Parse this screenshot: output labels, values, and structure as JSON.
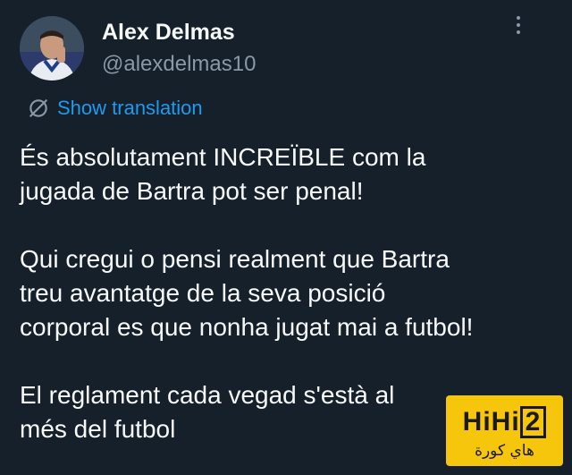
{
  "author": {
    "display_name": "Alex Delmas",
    "handle": "@alexdelmas10"
  },
  "more_menu_icon": "more-vertical-icon",
  "translation": {
    "icon": "globe-slash-icon",
    "label": "Show translation"
  },
  "tweet": {
    "paragraphs": [
      [
        "És absolutament INCREÏBLE com la",
        "jugada de Bartra pot ser penal!"
      ],
      [
        "Qui cregui o pensi realment que Bartra",
        "treu avantatge de la seva posició",
        "corporal es que nonha jugat mai a futbol!"
      ],
      [
        "El reglament cada vegad s'està al",
        "més del futbol"
      ]
    ]
  },
  "watermark": {
    "brand_prefix": "HiHi",
    "brand_digit": "2",
    "arabic": "هاي كورة"
  },
  "colors": {
    "background": "#15202b",
    "text": "#f7f9f9",
    "secondary": "#8b98a5",
    "link": "#1d9bf0",
    "watermark": "#f6c60c"
  }
}
